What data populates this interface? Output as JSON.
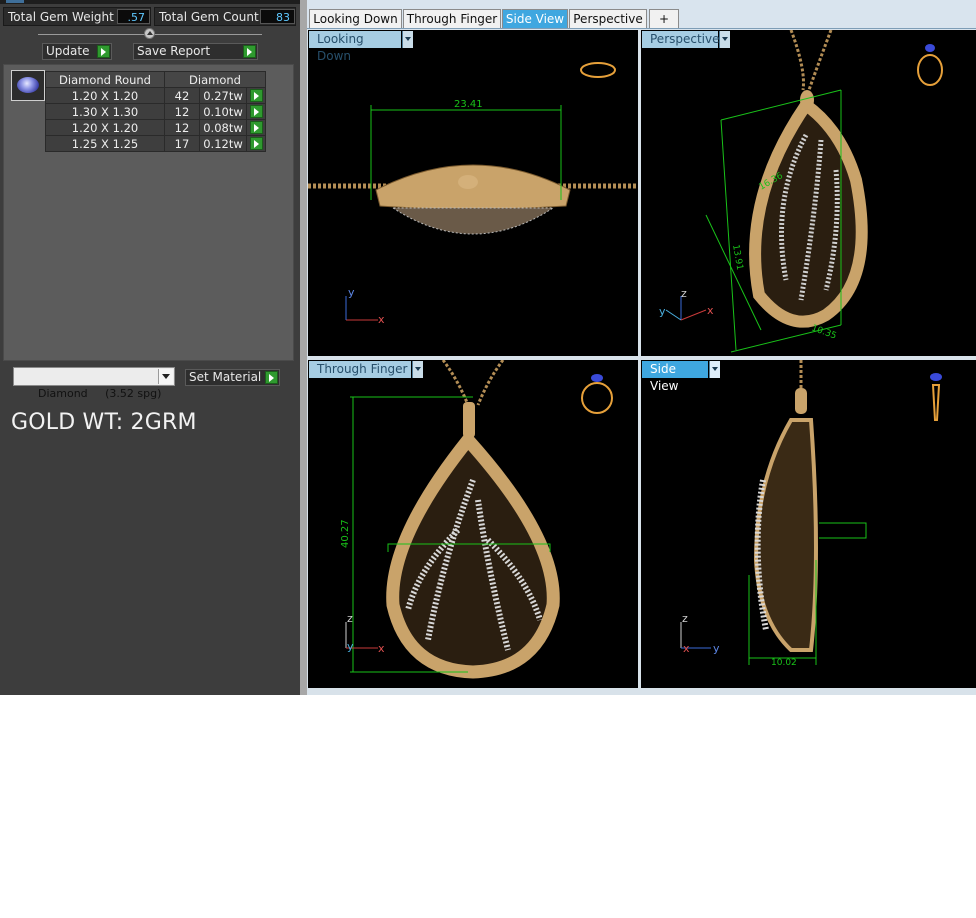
{
  "stats": {
    "total_gem_weight_label": "Total Gem Weight",
    "total_gem_weight_value": ".57",
    "total_gem_count_label": "Total Gem Count",
    "total_gem_count_value": "83"
  },
  "buttons": {
    "update_label": "Update",
    "save_report_label": "Save Report",
    "set_material_label": "Set Material"
  },
  "gem_table": {
    "header_shape": "Diamond Round",
    "header_type": "Diamond",
    "rows": [
      {
        "size": "1.20 X 1.20",
        "count": "42",
        "weight": "0.27tw"
      },
      {
        "size": "1.30 X 1.30",
        "count": "12",
        "weight": "0.10tw"
      },
      {
        "size": "1.20 X 1.20",
        "count": "12",
        "weight": "0.08tw"
      },
      {
        "size": "1.25 X 1.25",
        "count": "17",
        "weight": "0.12tw"
      }
    ]
  },
  "material": {
    "selected": "Diamond     (3.52 spg)"
  },
  "note": "GOLD WT: 2GRM",
  "tabs": [
    {
      "label": "Looking Down",
      "active": false
    },
    {
      "label": "Through Finger",
      "active": false
    },
    {
      "label": "Side View",
      "active": true
    },
    {
      "label": "Perspective",
      "active": false
    },
    {
      "label": "+",
      "active": false
    }
  ],
  "viewports": {
    "looking_down": {
      "label": "Looking Down",
      "dimension": "23.41",
      "axes": [
        "y",
        "x"
      ]
    },
    "perspective": {
      "label": "Perspective",
      "dimension_width": "16.36",
      "dimension_height": "13.91",
      "dimension_depth": "10.35",
      "axes": [
        "z",
        "y",
        "x"
      ]
    },
    "through_finger": {
      "label": "Through Finger",
      "dimension": "40.27",
      "axes": [
        "z",
        "y",
        "x"
      ]
    },
    "side_view": {
      "label": "Side View",
      "dimension": "10.02",
      "axes": [
        "z",
        "x",
        "y"
      ]
    }
  },
  "colors": {
    "gold": "#c9a36a",
    "gold_dark": "#8a6a3a",
    "measure_green": "#19c219",
    "active_tab": "#3fa7e0",
    "stat_value": "#5ec8ff"
  }
}
